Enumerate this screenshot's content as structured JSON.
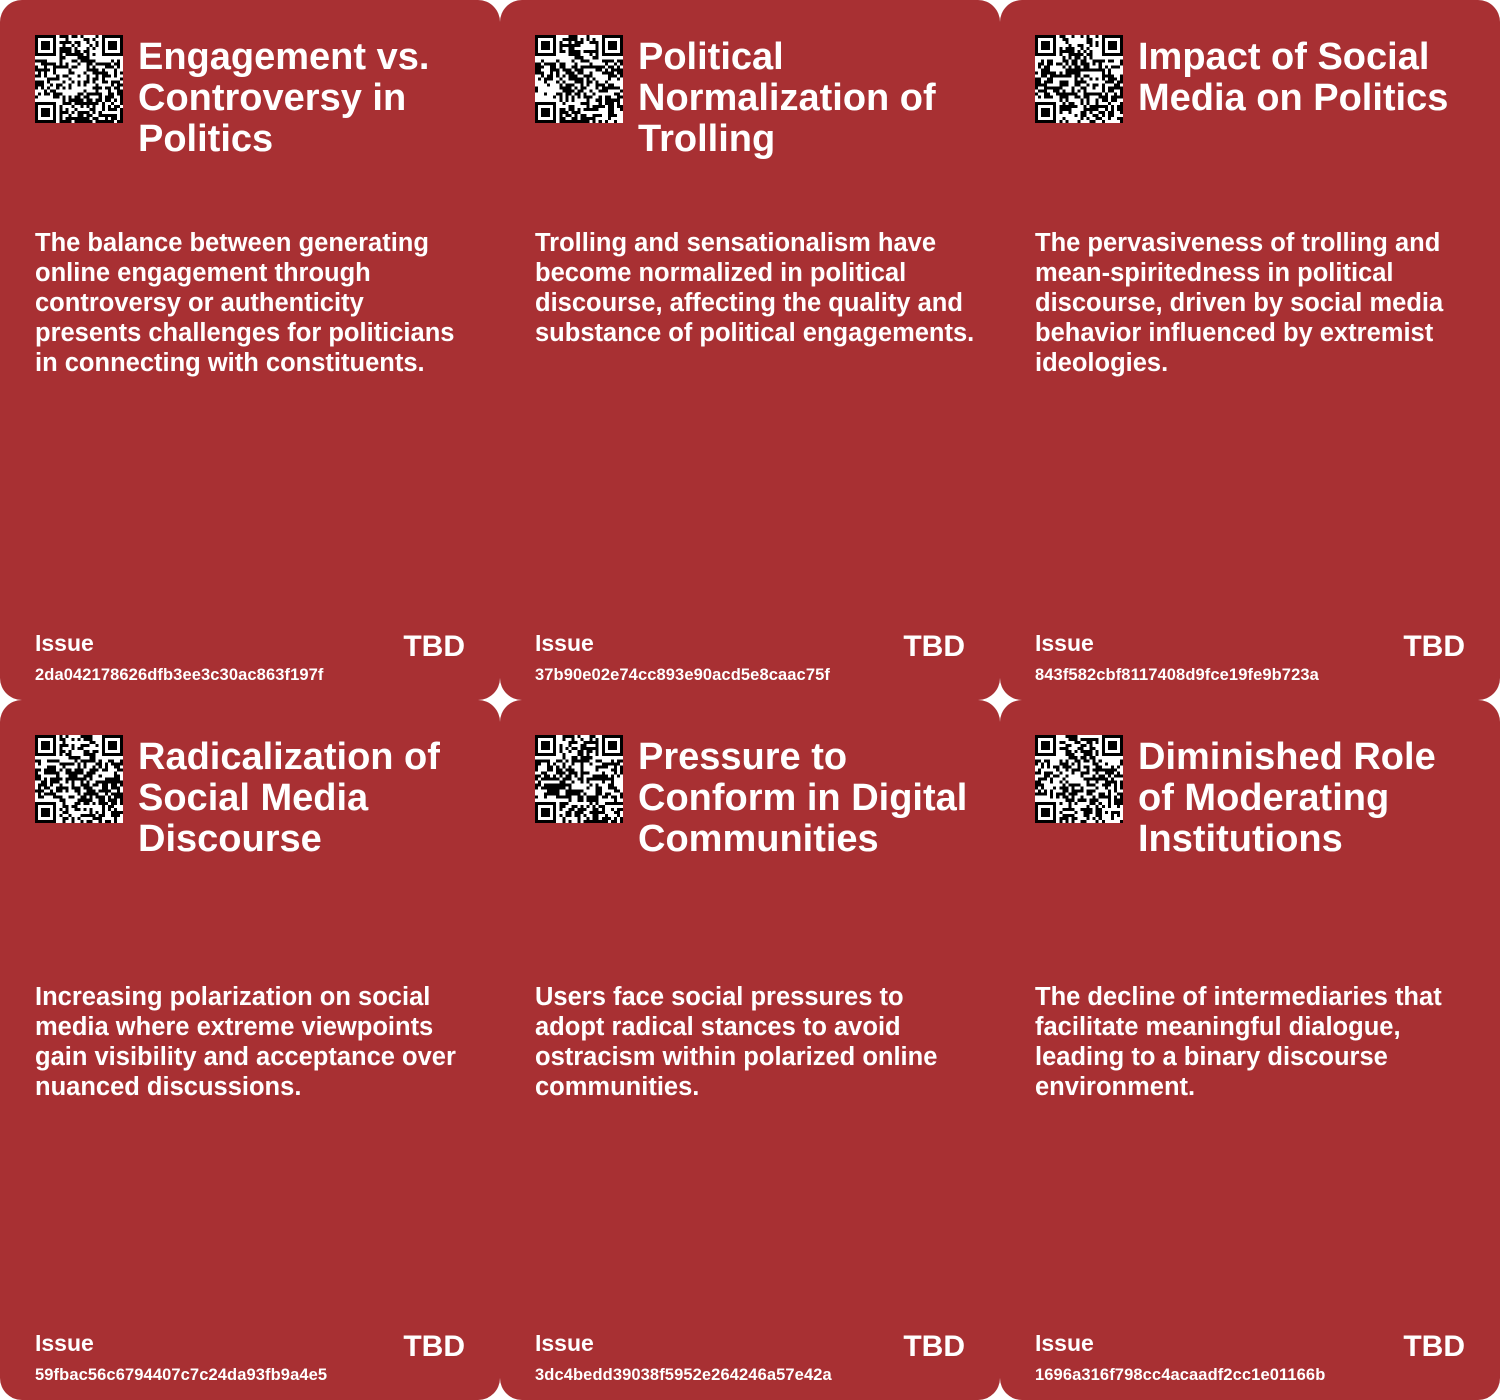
{
  "colors": {
    "card_background": "#a83033",
    "text": "#ffffff",
    "page_background": "#ffffff"
  },
  "cards": [
    {
      "title": "Engagement vs. Controversy in Politics",
      "description": "The balance between generating online engagement through controversy or authenticity presents challenges for politicians in connecting with constituents.",
      "issue_label": "Issue",
      "status": "TBD",
      "hash": "2da042178626dfb3ee3c30ac863f197f",
      "icon": "qr-code-icon"
    },
    {
      "title": "Political Normalization of Trolling",
      "description": "Trolling and sensationalism have become normalized in political discourse, affecting the quality and substance of political engagements.",
      "issue_label": "Issue",
      "status": "TBD",
      "hash": "37b90e02e74cc893e90acd5e8caac75f",
      "icon": "qr-code-icon"
    },
    {
      "title": "Impact of Social Media on Politics",
      "description": "The pervasiveness of trolling and mean-spiritedness in political discourse, driven by social media behavior influenced by extremist ideologies.",
      "issue_label": "Issue",
      "status": "TBD",
      "hash": "843f582cbf8117408d9fce19fe9b723a",
      "icon": "qr-code-icon"
    },
    {
      "title": "Radicalization of Social Media Discourse",
      "description": "Increasing polarization on social media where extreme viewpoints gain visibility and acceptance over nuanced discussions.",
      "issue_label": "Issue",
      "status": "TBD",
      "hash": "59fbac56c6794407c7c24da93fb9a4e5",
      "icon": "qr-code-icon"
    },
    {
      "title": "Pressure to Conform in Digital Communities",
      "description": "Users face social pressures to adopt radical stances to avoid ostracism within polarized online communities.",
      "issue_label": "Issue",
      "status": "TBD",
      "hash": "3dc4bedd39038f5952e264246a57e42a",
      "icon": "qr-code-icon"
    },
    {
      "title": "Diminished Role of Moderating Institutions",
      "description": "The decline of intermediaries that facilitate meaningful dialogue, leading to a binary discourse environment.",
      "issue_label": "Issue",
      "status": "TBD",
      "hash": "1696a316f798cc4acaadf2cc1e01166b",
      "icon": "qr-code-icon"
    }
  ]
}
